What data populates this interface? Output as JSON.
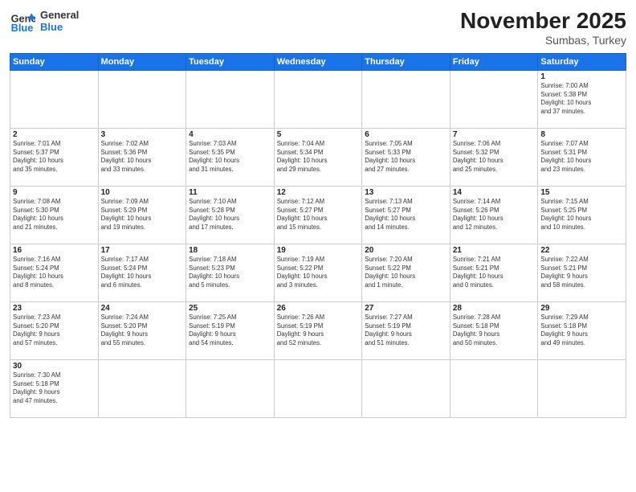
{
  "header": {
    "logo_general": "General",
    "logo_blue": "Blue",
    "title": "November 2025",
    "subtitle": "Sumbas, Turkey"
  },
  "weekdays": [
    "Sunday",
    "Monday",
    "Tuesday",
    "Wednesday",
    "Thursday",
    "Friday",
    "Saturday"
  ],
  "weeks": [
    [
      {
        "day": "",
        "info": ""
      },
      {
        "day": "",
        "info": ""
      },
      {
        "day": "",
        "info": ""
      },
      {
        "day": "",
        "info": ""
      },
      {
        "day": "",
        "info": ""
      },
      {
        "day": "",
        "info": ""
      },
      {
        "day": "1",
        "info": "Sunrise: 7:00 AM\nSunset: 5:38 PM\nDaylight: 10 hours\nand 37 minutes."
      }
    ],
    [
      {
        "day": "2",
        "info": "Sunrise: 7:01 AM\nSunset: 5:37 PM\nDaylight: 10 hours\nand 35 minutes."
      },
      {
        "day": "3",
        "info": "Sunrise: 7:02 AM\nSunset: 5:36 PM\nDaylight: 10 hours\nand 33 minutes."
      },
      {
        "day": "4",
        "info": "Sunrise: 7:03 AM\nSunset: 5:35 PM\nDaylight: 10 hours\nand 31 minutes."
      },
      {
        "day": "5",
        "info": "Sunrise: 7:04 AM\nSunset: 5:34 PM\nDaylight: 10 hours\nand 29 minutes."
      },
      {
        "day": "6",
        "info": "Sunrise: 7:05 AM\nSunset: 5:33 PM\nDaylight: 10 hours\nand 27 minutes."
      },
      {
        "day": "7",
        "info": "Sunrise: 7:06 AM\nSunset: 5:32 PM\nDaylight: 10 hours\nand 25 minutes."
      },
      {
        "day": "8",
        "info": "Sunrise: 7:07 AM\nSunset: 5:31 PM\nDaylight: 10 hours\nand 23 minutes."
      }
    ],
    [
      {
        "day": "9",
        "info": "Sunrise: 7:08 AM\nSunset: 5:30 PM\nDaylight: 10 hours\nand 21 minutes."
      },
      {
        "day": "10",
        "info": "Sunrise: 7:09 AM\nSunset: 5:29 PM\nDaylight: 10 hours\nand 19 minutes."
      },
      {
        "day": "11",
        "info": "Sunrise: 7:10 AM\nSunset: 5:28 PM\nDaylight: 10 hours\nand 17 minutes."
      },
      {
        "day": "12",
        "info": "Sunrise: 7:12 AM\nSunset: 5:27 PM\nDaylight: 10 hours\nand 15 minutes."
      },
      {
        "day": "13",
        "info": "Sunrise: 7:13 AM\nSunset: 5:27 PM\nDaylight: 10 hours\nand 14 minutes."
      },
      {
        "day": "14",
        "info": "Sunrise: 7:14 AM\nSunset: 5:26 PM\nDaylight: 10 hours\nand 12 minutes."
      },
      {
        "day": "15",
        "info": "Sunrise: 7:15 AM\nSunset: 5:25 PM\nDaylight: 10 hours\nand 10 minutes."
      }
    ],
    [
      {
        "day": "16",
        "info": "Sunrise: 7:16 AM\nSunset: 5:24 PM\nDaylight: 10 hours\nand 8 minutes."
      },
      {
        "day": "17",
        "info": "Sunrise: 7:17 AM\nSunset: 5:24 PM\nDaylight: 10 hours\nand 6 minutes."
      },
      {
        "day": "18",
        "info": "Sunrise: 7:18 AM\nSunset: 5:23 PM\nDaylight: 10 hours\nand 5 minutes."
      },
      {
        "day": "19",
        "info": "Sunrise: 7:19 AM\nSunset: 5:22 PM\nDaylight: 10 hours\nand 3 minutes."
      },
      {
        "day": "20",
        "info": "Sunrise: 7:20 AM\nSunset: 5:22 PM\nDaylight: 10 hours\nand 1 minute."
      },
      {
        "day": "21",
        "info": "Sunrise: 7:21 AM\nSunset: 5:21 PM\nDaylight: 10 hours\nand 0 minutes."
      },
      {
        "day": "22",
        "info": "Sunrise: 7:22 AM\nSunset: 5:21 PM\nDaylight: 9 hours\nand 58 minutes."
      }
    ],
    [
      {
        "day": "23",
        "info": "Sunrise: 7:23 AM\nSunset: 5:20 PM\nDaylight: 9 hours\nand 57 minutes."
      },
      {
        "day": "24",
        "info": "Sunrise: 7:24 AM\nSunset: 5:20 PM\nDaylight: 9 hours\nand 55 minutes."
      },
      {
        "day": "25",
        "info": "Sunrise: 7:25 AM\nSunset: 5:19 PM\nDaylight: 9 hours\nand 54 minutes."
      },
      {
        "day": "26",
        "info": "Sunrise: 7:26 AM\nSunset: 5:19 PM\nDaylight: 9 hours\nand 52 minutes."
      },
      {
        "day": "27",
        "info": "Sunrise: 7:27 AM\nSunset: 5:19 PM\nDaylight: 9 hours\nand 51 minutes."
      },
      {
        "day": "28",
        "info": "Sunrise: 7:28 AM\nSunset: 5:18 PM\nDaylight: 9 hours\nand 50 minutes."
      },
      {
        "day": "29",
        "info": "Sunrise: 7:29 AM\nSunset: 5:18 PM\nDaylight: 9 hours\nand 49 minutes."
      }
    ],
    [
      {
        "day": "30",
        "info": "Sunrise: 7:30 AM\nSunset: 5:18 PM\nDaylight: 9 hours\nand 47 minutes."
      },
      {
        "day": "",
        "info": ""
      },
      {
        "day": "",
        "info": ""
      },
      {
        "day": "",
        "info": ""
      },
      {
        "day": "",
        "info": ""
      },
      {
        "day": "",
        "info": ""
      },
      {
        "day": "",
        "info": ""
      }
    ]
  ]
}
